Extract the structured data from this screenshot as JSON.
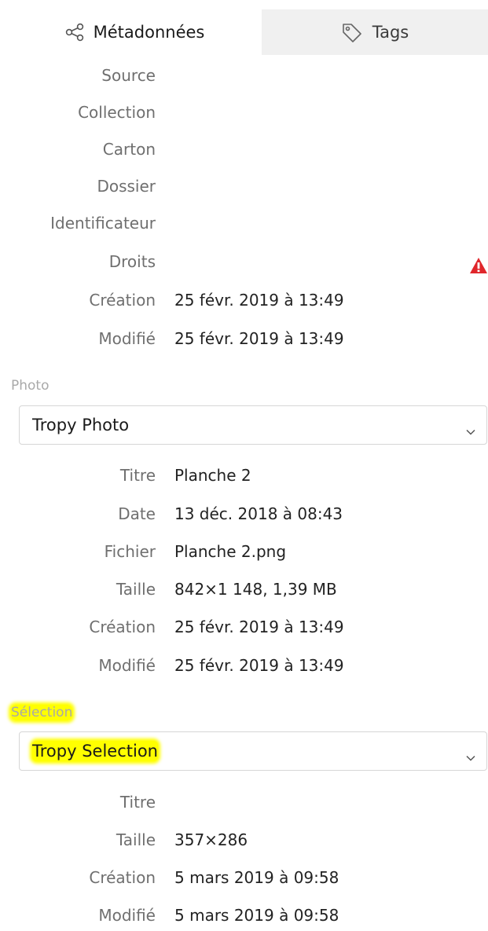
{
  "tabs": {
    "metadata": {
      "label": "Métadonnées",
      "icon": "share-nodes-icon"
    },
    "tags": {
      "label": "Tags",
      "icon": "tag-icon"
    }
  },
  "item_fields": [
    {
      "label": "Source",
      "value": ""
    },
    {
      "label": "Collection",
      "value": ""
    },
    {
      "label": "Carton",
      "value": ""
    },
    {
      "label": "Dossier",
      "value": ""
    },
    {
      "label": "Identificateur",
      "value": ""
    },
    {
      "label": "Droits",
      "value": "",
      "warning_icon": "warning-triangle-icon"
    },
    {
      "label": "Création",
      "value": "25 févr. 2019 à 13:49"
    },
    {
      "label": "Modifié",
      "value": "25 févr. 2019 à 13:49"
    }
  ],
  "photo": {
    "heading": "Photo",
    "template": "Tropy Photo",
    "fields": [
      {
        "label": "Titre",
        "value": "Planche 2"
      },
      {
        "label": "Date",
        "value": "13 déc. 2018 à 08:43"
      },
      {
        "label": "Fichier",
        "value": "Planche 2.png"
      },
      {
        "label": "Taille",
        "value": "842×1 148, 1,39 MB"
      },
      {
        "label": "Création",
        "value": "25 févr. 2019 à 13:49"
      },
      {
        "label": "Modifié",
        "value": "25 févr. 2019 à 13:49"
      }
    ]
  },
  "selection": {
    "heading": "Sélection",
    "template": "Tropy Selection",
    "fields": [
      {
        "label": "Titre",
        "value": ""
      },
      {
        "label": "Taille",
        "value": "357×286"
      },
      {
        "label": "Création",
        "value": "5 mars 2019 à 09:58"
      },
      {
        "label": "Modifié",
        "value": "5 mars 2019 à 09:58"
      }
    ]
  },
  "colors": {
    "highlight": "#ffff00",
    "warning": "#e0262b",
    "label_text": "#6f6f6f",
    "heading_text": "#a9a9a9",
    "inactive_tab_bg": "#f0f0f0"
  }
}
